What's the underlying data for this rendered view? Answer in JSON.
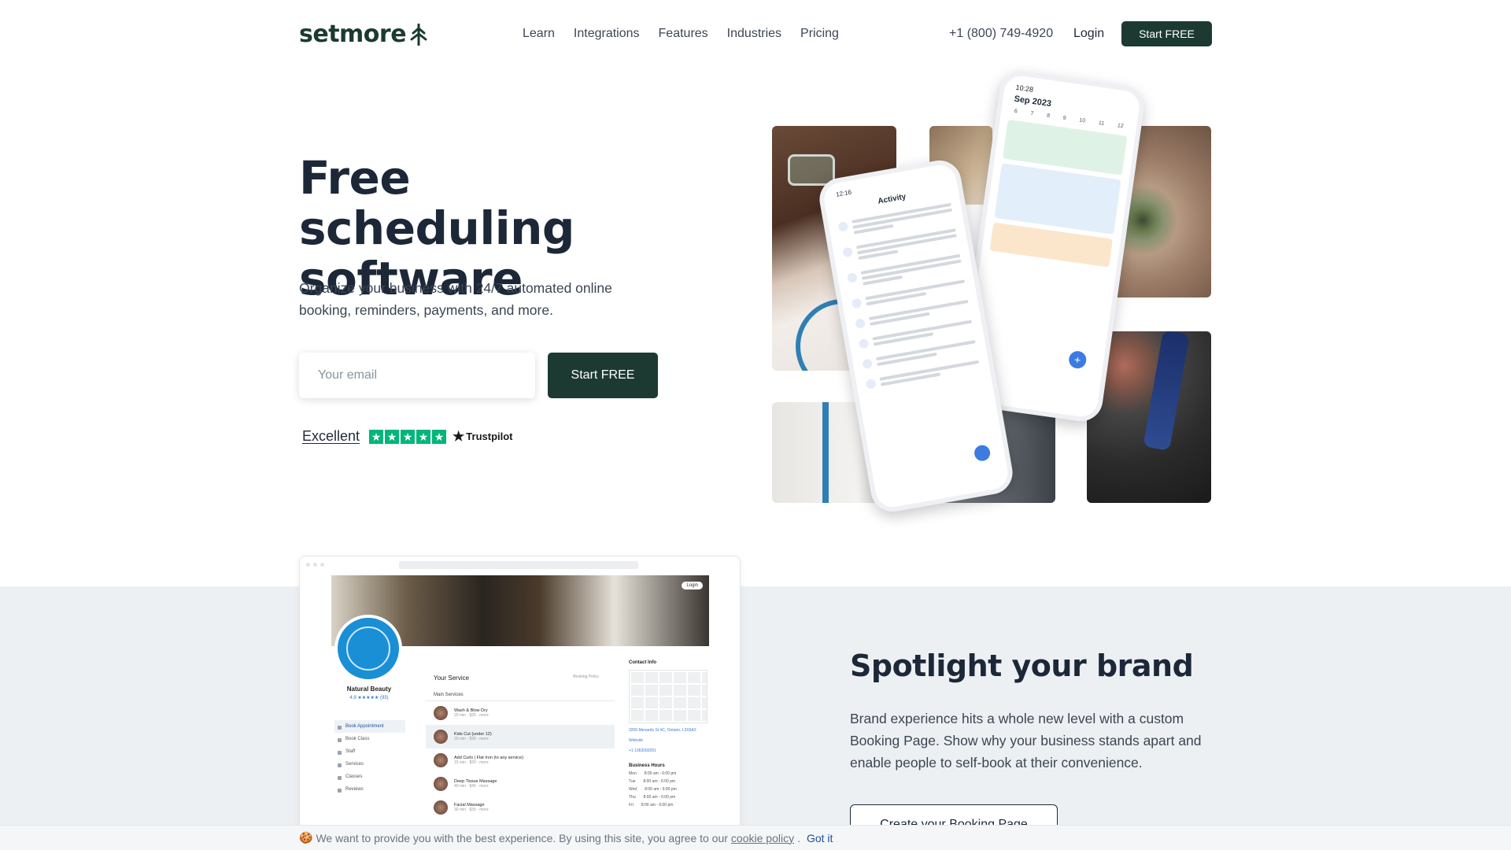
{
  "brand": {
    "name": "setmore",
    "color": "#1c3a32"
  },
  "nav": {
    "items": [
      "Learn",
      "Integrations",
      "Features",
      "Industries",
      "Pricing"
    ],
    "phone": "+1 (800) 749-4920",
    "login": "Login",
    "cta": "Start FREE"
  },
  "hero": {
    "title": "Free scheduling software",
    "subtitle": "Organize your business with 24/7 automated online booking, reminders, payments, and more.",
    "email_placeholder": "Your email",
    "cta": "Start FREE",
    "rating_label": "Excellent",
    "stars": 5,
    "trustpilot": "Trustpilot"
  },
  "phone_calendar": {
    "time": "10:28",
    "month": "Sep 2023",
    "days": [
      "6",
      "7",
      "8",
      "9",
      "10",
      "11",
      "12"
    ]
  },
  "phone_activity": {
    "time": "12:16",
    "title": "Activity"
  },
  "booking_page": {
    "login": "Login",
    "business_name": "Natural Beauty",
    "rating": "4.9 ★★★★★ (93)",
    "menu": [
      "Book Appointment",
      "Book Class",
      "Staff",
      "Services",
      "Classes",
      "Reviews"
    ],
    "section_title": "Your Service",
    "policy": "Booking Policy",
    "group": "Main Services",
    "services": [
      {
        "name": "Wash & Blow Dry",
        "meta": "20 min · $25 · more"
      },
      {
        "name": "Kids Cut (under 12)",
        "meta": "20 min · $30 · more"
      },
      {
        "name": "Add Curls | Flat Iron (to any service)",
        "meta": "15 min · $20 · more"
      },
      {
        "name": "Deep Tissue Massage",
        "meta": "40 min · $45 · more"
      },
      {
        "name": "Facial Massage",
        "meta": "30 min · $35 · more"
      }
    ],
    "contact_label": "Contact Info",
    "address": "3200 Menards St #C, Ontario, L3X6A2",
    "website": "Website",
    "phone": "+1 1363092051",
    "hours_label": "Business Hours",
    "hours": [
      {
        "day": "Mon",
        "time": "8:00 am - 6:00 pm"
      },
      {
        "day": "Tue",
        "time": "8:00 am - 6:00 pm"
      },
      {
        "day": "Wed",
        "time": "8:00 am - 6:00 pm"
      },
      {
        "day": "Thu",
        "time": "8:00 am - 6:00 pm"
      },
      {
        "day": "Fri",
        "time": "8:00 am - 6:00 pm"
      }
    ]
  },
  "spotlight": {
    "title": "Spotlight your brand",
    "text": "Brand experience hits a whole new level with a custom Booking Page. Show why your business stands apart and enable people to self-book at their convenience.",
    "cta": "Create your Booking Page"
  },
  "cookie": {
    "icon": "cookie-icon",
    "text": "We want to provide you with the best experience. By using this site, you agree to our",
    "link": "cookie policy",
    "accept": "Got it"
  }
}
